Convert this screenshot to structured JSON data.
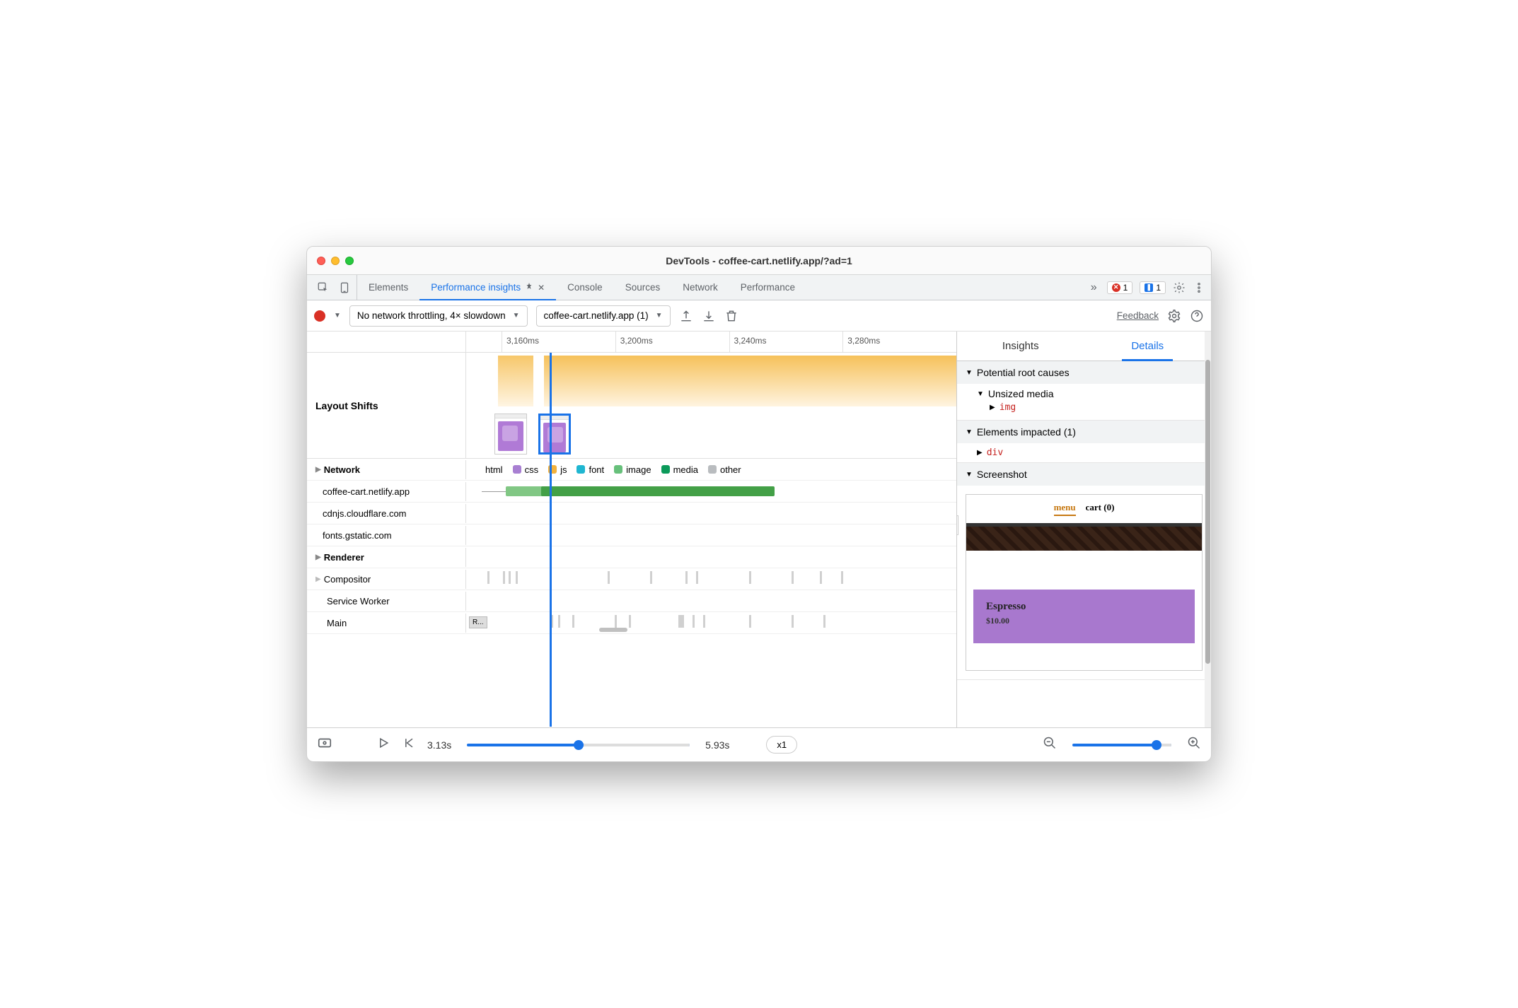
{
  "window": {
    "title": "DevTools - coffee-cart.netlify.app/?ad=1"
  },
  "tabs": {
    "items": [
      "Elements",
      "Performance insights",
      "Console",
      "Sources",
      "Network",
      "Performance"
    ],
    "active": "Performance insights"
  },
  "badges": {
    "errors": "1",
    "messages": "1"
  },
  "toolbar": {
    "throttle": "No network throttling, 4× slowdown",
    "target": "coffee-cart.netlify.app (1)",
    "feedback": "Feedback"
  },
  "timeline": {
    "ticks": [
      "3,160ms",
      "3,200ms",
      "3,240ms",
      "3,280ms"
    ]
  },
  "rows": {
    "layoutShifts": "Layout Shifts",
    "network": "Network",
    "renderer": "Renderer",
    "compositor": "Compositor",
    "serviceWorker": "Service Worker",
    "main": "Main",
    "mainBlock": "R..."
  },
  "legend": {
    "html": "html",
    "css": "css",
    "js": "js",
    "font": "font",
    "image": "image",
    "media": "media",
    "other": "other"
  },
  "legendColors": {
    "html": "#6a9ef0",
    "css": "#a87fd2",
    "js": "#f2b13c",
    "font": "#1fb6d1",
    "image": "#67c07b",
    "media": "#0b9a5a",
    "other": "#b9bcbf"
  },
  "networkHosts": [
    "coffee-cart.netlify.app",
    "cdnjs.cloudflare.com",
    "fonts.gstatic.com"
  ],
  "details": {
    "tabs": {
      "insights": "Insights",
      "details": "Details"
    },
    "rootCauses": "Potential root causes",
    "unsized": "Unsized media",
    "img": "img",
    "impacted": "Elements impacted (1)",
    "div": "div",
    "screenshot": "Screenshot",
    "shotNav": {
      "menu": "menu",
      "cart": "cart (0)"
    },
    "product": {
      "name": "Espresso",
      "price": "$10.00"
    }
  },
  "footer": {
    "start": "3.13s",
    "end": "5.93s",
    "speed": "x1"
  }
}
